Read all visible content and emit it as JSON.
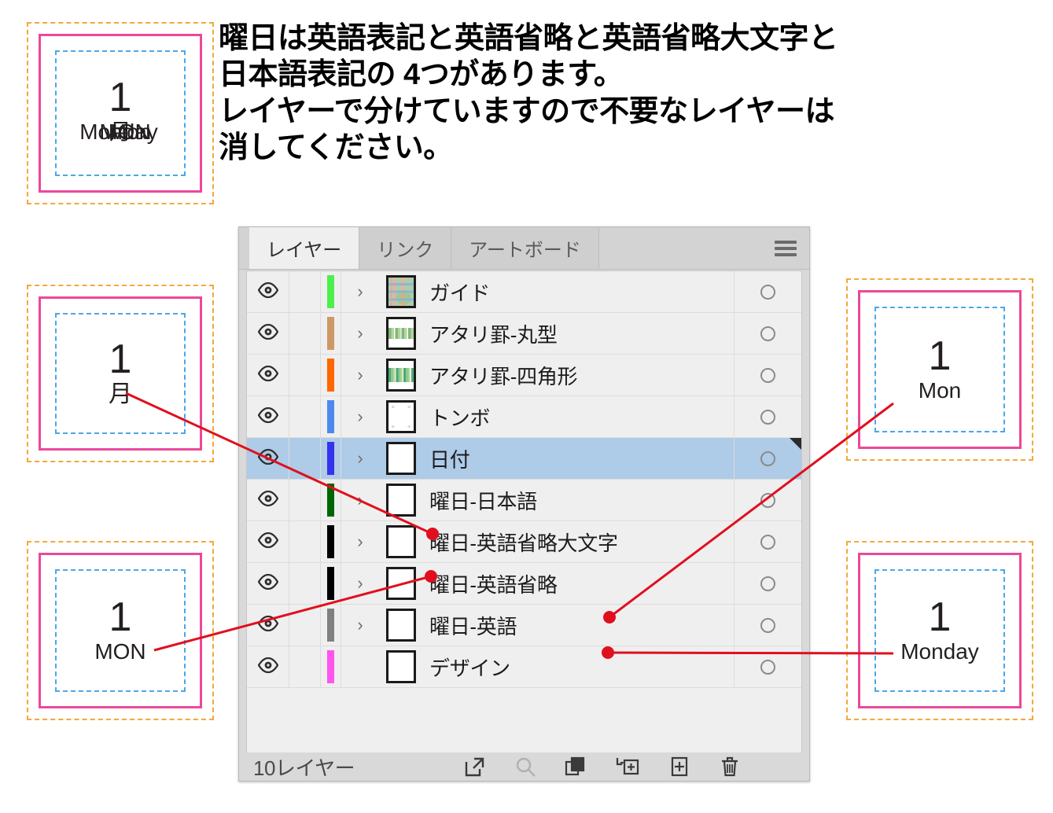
{
  "headline": {
    "text": "曜日は英語表記と英語省略と英語省略大文字と\n日本語表記の 4つがあります。\nレイヤーで分けていますので不要なレイヤーは\n消してください。"
  },
  "cards": {
    "all": {
      "name": "all-variants",
      "number": "1",
      "labels": [
        "Monday",
        "Mon",
        "MON",
        "月"
      ]
    },
    "japanese": {
      "name": "japanese",
      "number": "1",
      "label": "月"
    },
    "upper_abbrev": {
      "name": "upper-abbrev",
      "number": "1",
      "label": "MON"
    },
    "abbrev": {
      "name": "abbrev",
      "number": "1",
      "label": "Mon"
    },
    "full": {
      "name": "full-english",
      "number": "1",
      "label": "Monday"
    }
  },
  "panel": {
    "tabs": [
      {
        "label": "レイヤー",
        "active": true
      },
      {
        "label": "リンク",
        "active": false
      },
      {
        "label": "アートボード",
        "active": false
      }
    ],
    "menu_icon": "hamburger-menu-icon",
    "layers": [
      {
        "name": "ガイド",
        "color": "#4cf04c",
        "selected": false,
        "expandable": true,
        "thumb": "guide",
        "visible": true
      },
      {
        "name": "アタリ罫-丸型",
        "color": "#cc9966",
        "selected": false,
        "expandable": true,
        "thumb": "round",
        "visible": true
      },
      {
        "name": "アタリ罫-四角形",
        "color": "#ff6600",
        "selected": false,
        "expandable": true,
        "thumb": "square",
        "visible": true
      },
      {
        "name": "トンボ",
        "color": "#4d88ee",
        "selected": false,
        "expandable": true,
        "thumb": "trim",
        "visible": true
      },
      {
        "name": "日付",
        "color": "#3333ee",
        "selected": true,
        "expandable": true,
        "thumb": "blank",
        "visible": true
      },
      {
        "name": "曜日-日本語",
        "color": "#006600",
        "selected": false,
        "expandable": true,
        "thumb": "blank",
        "visible": true
      },
      {
        "name": "曜日-英語省略大文字",
        "color": "#000000",
        "selected": false,
        "expandable": true,
        "thumb": "blank",
        "visible": true
      },
      {
        "name": "曜日-英語省略",
        "color": "#000000",
        "selected": false,
        "expandable": true,
        "thumb": "blank",
        "visible": true
      },
      {
        "name": "曜日-英語",
        "color": "#808080",
        "selected": false,
        "expandable": true,
        "thumb": "blank",
        "visible": true
      },
      {
        "name": "デザイン",
        "color": "#ff55ee",
        "selected": false,
        "expandable": false,
        "thumb": "blank",
        "visible": true
      }
    ],
    "footer": {
      "count_label": "10レイヤー",
      "icons": [
        "release-to-layers-icon",
        "locate-object-icon",
        "duplicate-layer-icon",
        "create-sublayer-icon",
        "new-layer-icon",
        "delete-layer-icon"
      ]
    }
  },
  "colors": {
    "selection": "#aecbe8",
    "annotation_line": "#e10f1e",
    "card_outer_dash": "#f2a93b",
    "card_border": "#ec4899",
    "card_guide_dash": "#4aa8e8",
    "panel_bg": "#d9d9d9",
    "row_bg": "#efefef"
  }
}
